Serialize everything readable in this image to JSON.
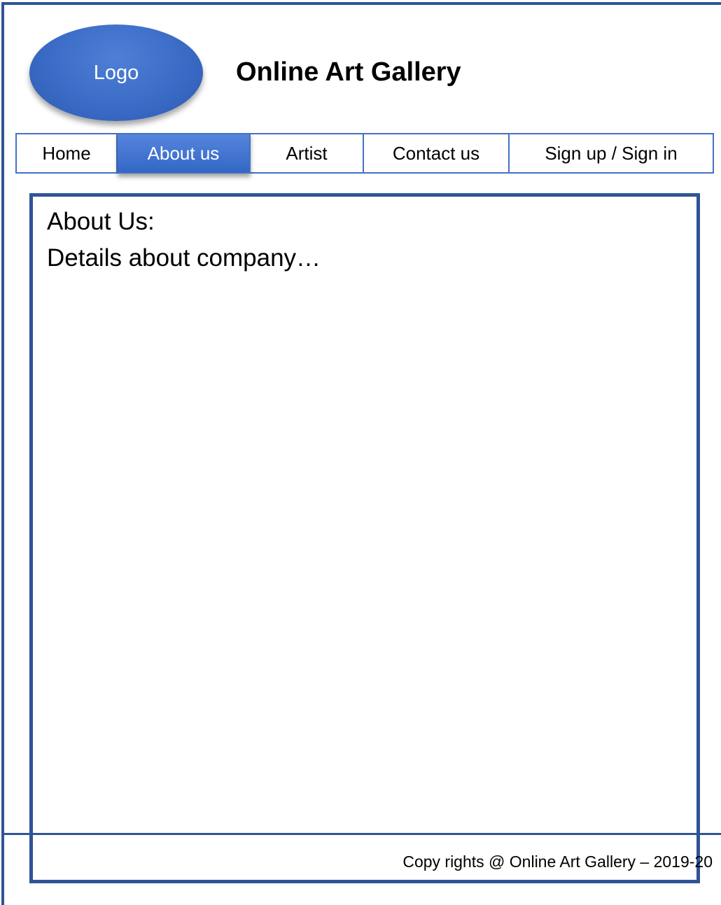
{
  "header": {
    "logo_label": "Logo",
    "site_title": "Online Art Gallery"
  },
  "nav": {
    "items": [
      {
        "label": "Home",
        "active": false
      },
      {
        "label": "About us",
        "active": true
      },
      {
        "label": "Artist",
        "active": false
      },
      {
        "label": "Contact us",
        "active": false
      },
      {
        "label": "Sign up / Sign in",
        "active": false
      }
    ]
  },
  "content": {
    "heading": "About Us:",
    "text": "Details about company…"
  },
  "footer": {
    "copyright": "Copy rights @ Online Art Gallery – 2019-20"
  },
  "colors": {
    "frame_border": "#2f5496",
    "nav_border": "#4472c4",
    "active_tab": "#3a6bc6",
    "logo_fill": "#3a6bc6"
  }
}
